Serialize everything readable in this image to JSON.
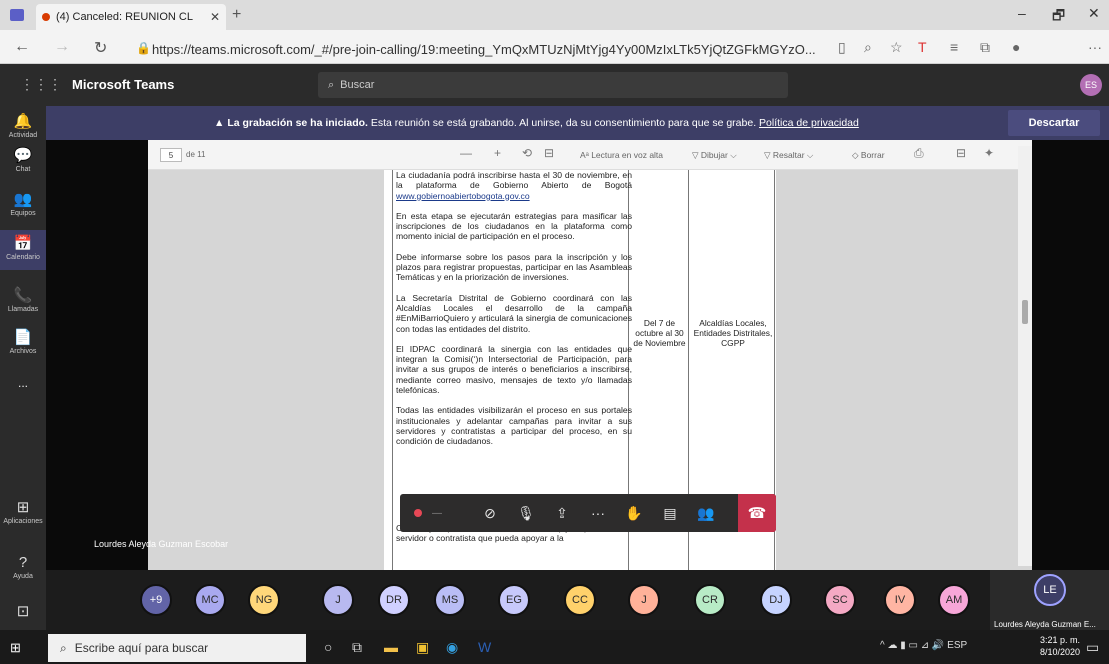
{
  "browser": {
    "tab_title": "(4) Canceled: REUNION CL",
    "url": "https://teams.microsoft.com/_#/pre-join-calling/19:meeting_YmQxMTUzNjMtYjg4Yy00MzIxLTk5YjQtZGFkMGYzO...",
    "new_tab": "+",
    "win_min": "–",
    "win_max": "🗗",
    "win_close": "✕"
  },
  "teams": {
    "app_name": "Microsoft Teams",
    "search_placeholder": "Buscar",
    "user_initials": "ES"
  },
  "rail": [
    {
      "label": "Actividad",
      "icon": "bell-icon",
      "glyph": "🔔"
    },
    {
      "label": "Chat",
      "icon": "chat-icon",
      "glyph": "💬"
    },
    {
      "label": "Equipos",
      "icon": "teams-icon",
      "glyph": "👥"
    },
    {
      "label": "Calendario",
      "icon": "calendar-icon",
      "glyph": "📅"
    },
    {
      "label": "Llamadas",
      "icon": "phone-icon",
      "glyph": "📞"
    },
    {
      "label": "Archivos",
      "icon": "file-icon",
      "glyph": "📄"
    },
    {
      "label": "...",
      "icon": "more-icon",
      "glyph": ""
    },
    {
      "label": "Aplicaciones",
      "icon": "apps-icon",
      "glyph": "⊞"
    },
    {
      "label": "Ayuda",
      "icon": "help-icon",
      "glyph": "?"
    }
  ],
  "banner": {
    "bold": "La grabación se ha iniciado.",
    "text": "Esta reunión se está grabando. Al unirse, da su consentimiento para que se grabe.",
    "link": "Política de privacidad",
    "dismiss": "Descartar"
  },
  "pdf": {
    "page": "5",
    "page_total": "de 11",
    "read_aloud": "Lectura en voz alta",
    "draw": "Dibujar",
    "highlight": "Resaltar",
    "erase": "Borrar"
  },
  "doc": {
    "p1_a": "La ciudadanía podrá inscribirse hasta el 30 de noviembre, en la plataforma de Gobierno Abierto de Bogotá",
    "p1_link": "www.gobiernoabiertobogota.gov.co",
    "p2": "En esta etapa se ejecutarán estrategias para masificar las inscripciones de los ciudadanos en la plataforma como momento inicial de participación en el proceso.",
    "p3": "Debe informarse sobre los pasos para la inscripción y los plazos para registrar propuestas, participar en las Asambleas Temáticas y en la priorización de inversiones.",
    "p4": "La Secretaría Distrital de Gobierno coordinará con las Alcaldías Locales el desarrollo de la campaña #EnMiBarrioQuiero y articulará la sinergia de comunicaciones con todas las entidades del distrito.",
    "p5": "El IDPAC coordinará la sinergia con las entidades que integran la Comisi(‘)n Intersectorial de Participación, para invitar a sus grupos de interés o beneficiarios a inscribirse, mediante correo masivo, mensajes de texto y/o llamadas telefónicas.",
    "p6": "Todas las entidades visibilizarán el proceso en sus portales institucionales y adelantar campañas para invitar a sus servidores y contratistas a participar del proceso, en su condición de ciudadanos.",
    "p7": "CADES y Super CADES, bibliotecas, etc.) y disponer de un servidor o contratista que pueda apoyar a la",
    "date_col": "Del 7 de octubre al 30 de Noviembre",
    "resp_col": "Alcaldías Locales, Entidades Distritales, CGPP"
  },
  "call": {
    "presenter": "Lourdes Aleyda Guzman Escobar"
  },
  "participants": [
    {
      "initials": "+9",
      "color": "#6264a7"
    },
    {
      "initials": "MC",
      "color": "#a9a9ef"
    },
    {
      "initials": "NG",
      "color": "#ffd77a"
    },
    {
      "initials": "J",
      "color": "#b8b9f0"
    },
    {
      "initials": "DR",
      "color": "#d0d0ff"
    },
    {
      "initials": "MS",
      "color": "#b9bdf5"
    },
    {
      "initials": "EG",
      "color": "#c7c9fb"
    },
    {
      "initials": "CC",
      "color": "#ffd16b"
    },
    {
      "initials": "J",
      "color": "#ffb199"
    },
    {
      "initials": "CR",
      "color": "#b8ebc6"
    },
    {
      "initials": "DJ",
      "color": "#c6d3ff"
    },
    {
      "initials": "SC",
      "color": "#f4a9c4"
    },
    {
      "initials": "IV",
      "color": "#ffb5a3"
    },
    {
      "initials": "AM",
      "color": "#f7a6d8"
    }
  ],
  "self": {
    "initials": "LE",
    "name": "Lourdes Aleyda Guzman E..."
  },
  "taskbar": {
    "search": "Escribe aquí para buscar",
    "lang": "ESP",
    "time": "3:21 p. m.",
    "date": "8/10/2020"
  }
}
